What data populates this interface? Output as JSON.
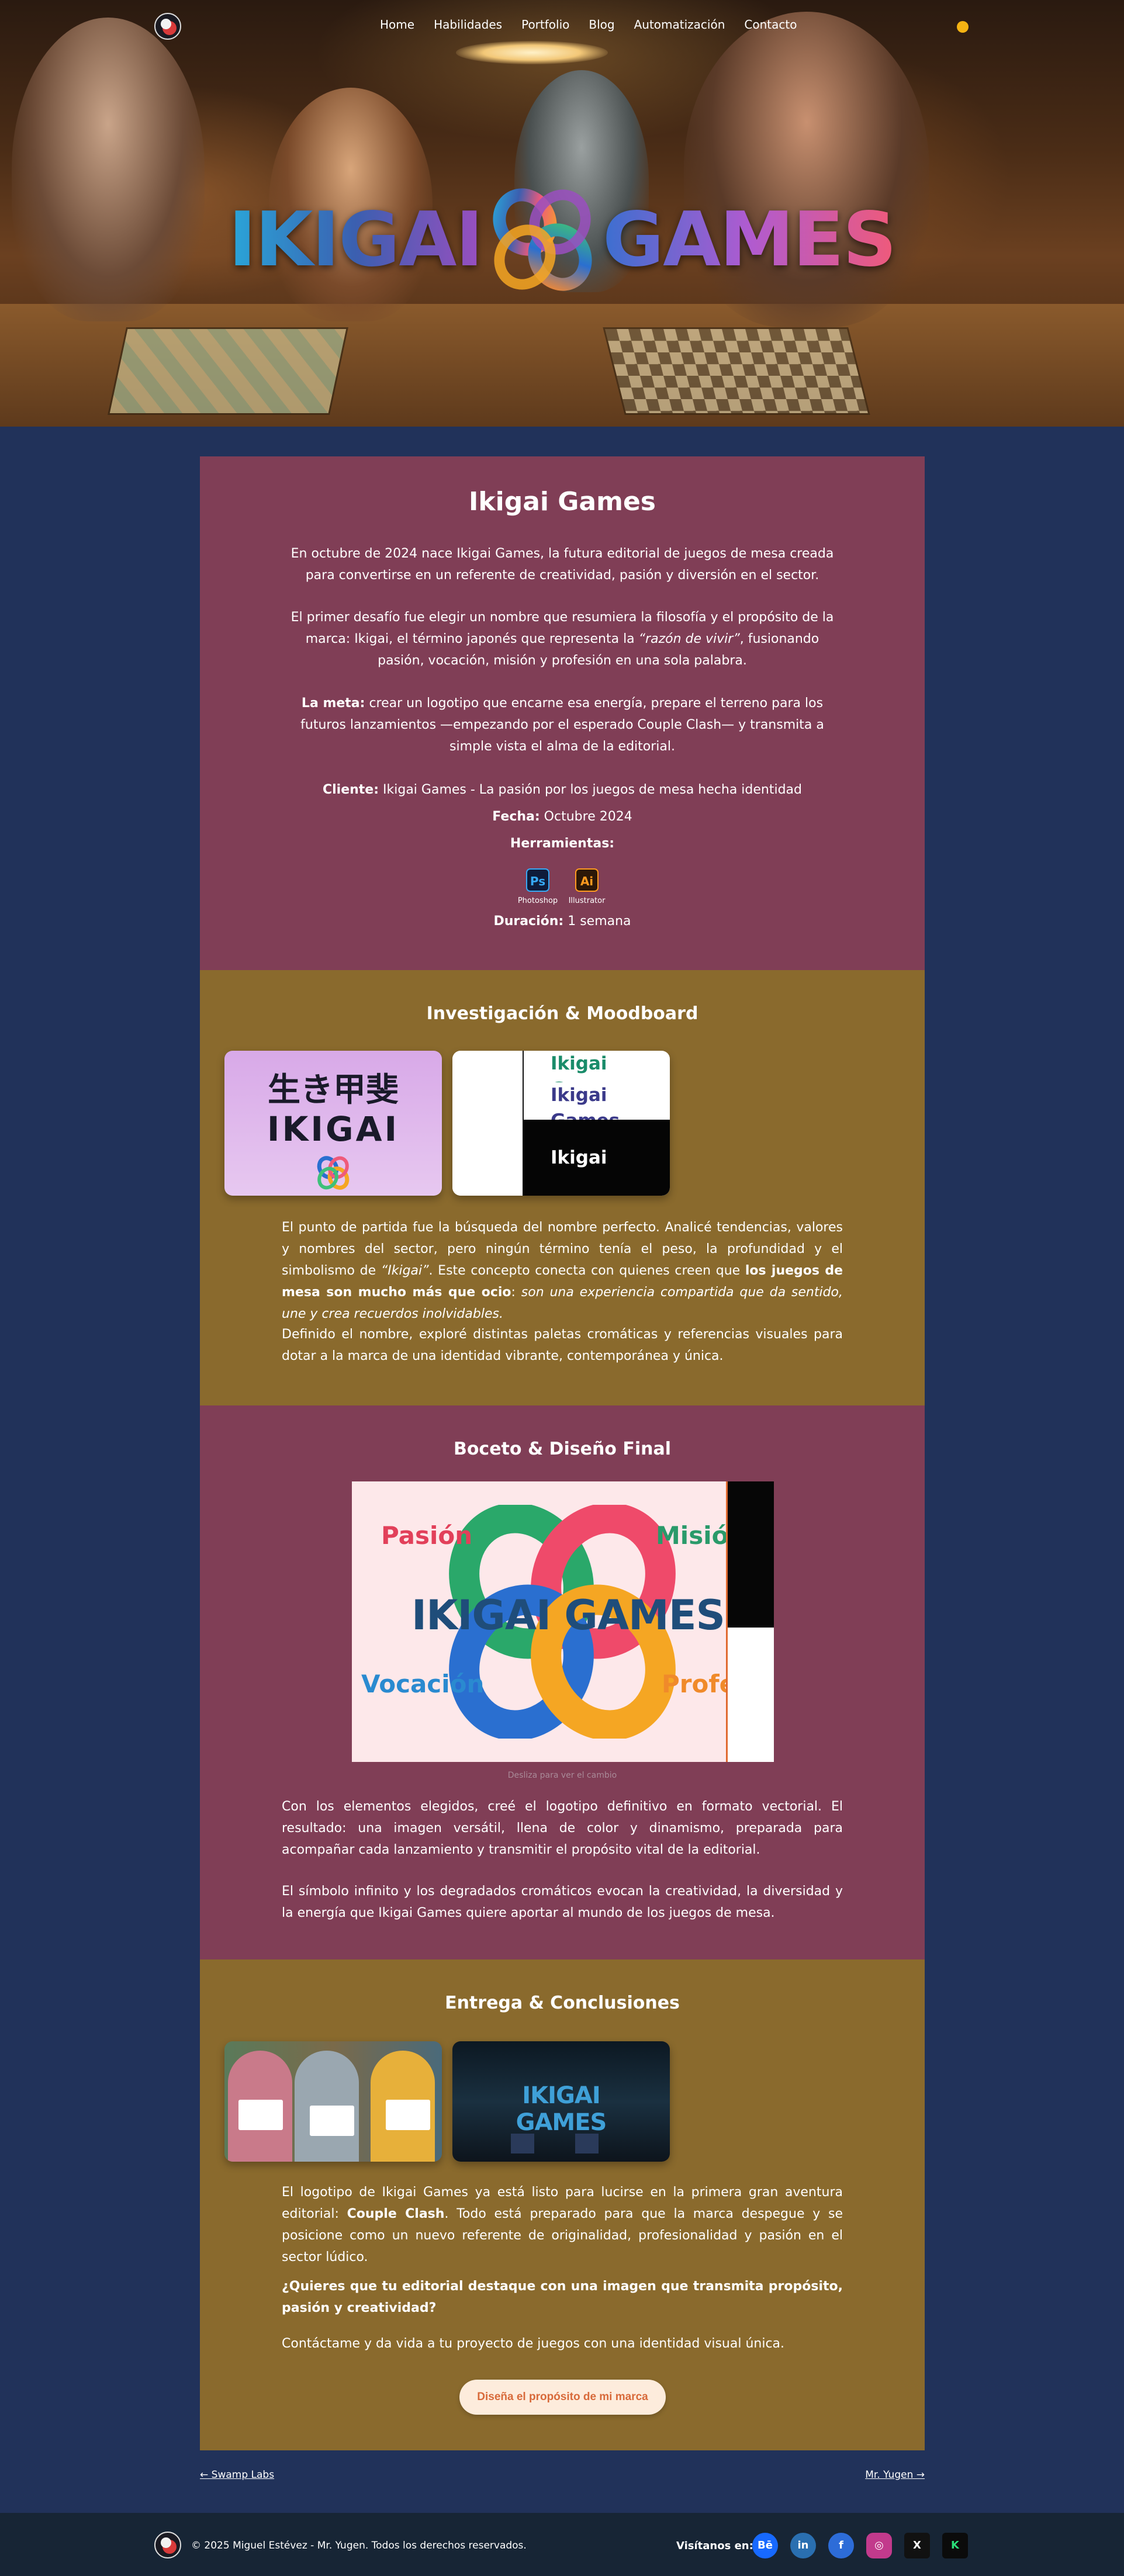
{
  "nav": {
    "items": [
      "Home",
      "Habilidades",
      "Portfolio",
      "Blog",
      "Automatización",
      "Contacto"
    ]
  },
  "hero": {
    "brand_left": "IKIGAI",
    "brand_right": "GAMES"
  },
  "intro": {
    "title": "Ikigai Games",
    "p1": "En octubre de 2024 nace Ikigai Games, la futura editorial de juegos de mesa creada para convertirse en un referente de creatividad, pasión y diversión en el sector.",
    "p2_a": "El primer desafío fue elegir un nombre que resumiera la filosofía y el propósito de la marca: Ikigai, el término japonés que representa la ",
    "p2_em": "“razón de vivir”",
    "p2_b": ", fusionando pasión, vocación, misión y profesión en una sola palabra.",
    "p3_label": "La meta:",
    "p3_text": " crear un logotipo que encarne esa energía, prepare el terreno para los futuros lanzamientos —empezando por el esperado Couple Clash— y transmita a simple vista el alma de la editorial.",
    "client_label": "Cliente:",
    "client_value": " Ikigai Games - La pasión por los juegos de mesa hecha identidad",
    "date_label": "Fecha:",
    "date_value": " Octubre 2024",
    "tools_label": "Herramientas:",
    "tools": [
      {
        "badge": "Ps",
        "name": "Photoshop"
      },
      {
        "badge": "Ai",
        "name": "Illustrator"
      }
    ],
    "duration_label": "Duración:",
    "duration_value": " 1 semana"
  },
  "moodboard": {
    "title": "Investigación & Moodboard",
    "img1_kanji": "生き甲斐",
    "img1_word": "IKIGAI",
    "img2_rows": [
      "Ikigai Games",
      "Ikigai Games",
      "Ikigai Games"
    ],
    "p1_a": "El punto de partida fue la búsqueda del nombre perfecto. Analicé tendencias, valores y nombres del sector, pero ningún término tenía el peso, la profundidad y el simbolismo de ",
    "p1_em": "“Ikigai”",
    "p1_b": ". Este concepto conecta con quienes creen que ",
    "p1_strong": "los juegos de mesa son mucho más que ocio",
    "p1_c": ": ",
    "p1_em2": "son una experiencia compartida que da sentido, une y crea recuerdos inolvidables.",
    "p2": "Definido el nombre, exploré distintas paletas cromáticas y referencias visuales para dotar a la marca de una identidad vibrante, contemporánea y única."
  },
  "sketch": {
    "title": "Boceto & Diseño Final",
    "words": [
      "Pasión",
      "Misión",
      "Vocación",
      "Profe"
    ],
    "logo": "IKIGAI GAMES",
    "caption": "Desliza para ver el cambio",
    "p1": "Con los elementos elegidos, creé el logotipo definitivo en formato vectorial. El resultado: una imagen versátil, llena de color y dinamismo, preparada para acompañar cada lanzamiento y transmitir el propósito vital de la editorial.",
    "p2": "El símbolo infinito y los degradados cromáticos evocan la creatividad, la diversidad y la energía que Ikigai Games quiere aportar al mundo de los juegos de mesa."
  },
  "final": {
    "title": "Entrega & Conclusiones",
    "store_word": "IKIGAI GAMES",
    "p1_a": "El logotipo de Ikigai Games ya está listo para lucirse en la primera gran aventura editorial: ",
    "p1_strong": "Couple Clash",
    "p1_b": ". Todo está preparado para que la marca despegue y se posicione como un nuevo referente de originalidad, profesionalidad y pasión en el sector lúdico.",
    "p2": "¿Quieres que tu editorial destaque con una imagen que transmita propósito, pasión y creatividad?",
    "p3": "Contáctame y da vida a tu proyecto de juegos con una identidad visual única.",
    "cta": "Diseña el propósito de mi marca"
  },
  "pager": {
    "prev": "← Swamp Labs",
    "next": "Mr. Yugen →"
  },
  "footer": {
    "copyright": "© 2025 Miguel Estévez - Mr. Yugen. Todos los derechos reservados.",
    "visit_label": "Visítanos en:",
    "socials": [
      {
        "icon": "behance-icon",
        "glyph": "Bē",
        "color": "#1769ff"
      },
      {
        "icon": "linkedin-icon",
        "glyph": "in",
        "color": "#2a6fb0"
      },
      {
        "icon": "facebook-icon",
        "glyph": "f",
        "color": "#2d6cd8"
      },
      {
        "icon": "instagram-icon",
        "glyph": "◎",
        "color": "#c23a8c"
      },
      {
        "icon": "x-icon",
        "glyph": "X",
        "color": "#111111"
      },
      {
        "icon": "kickstarter-icon",
        "glyph": "K",
        "color": "#0b0b0b"
      }
    ]
  }
}
